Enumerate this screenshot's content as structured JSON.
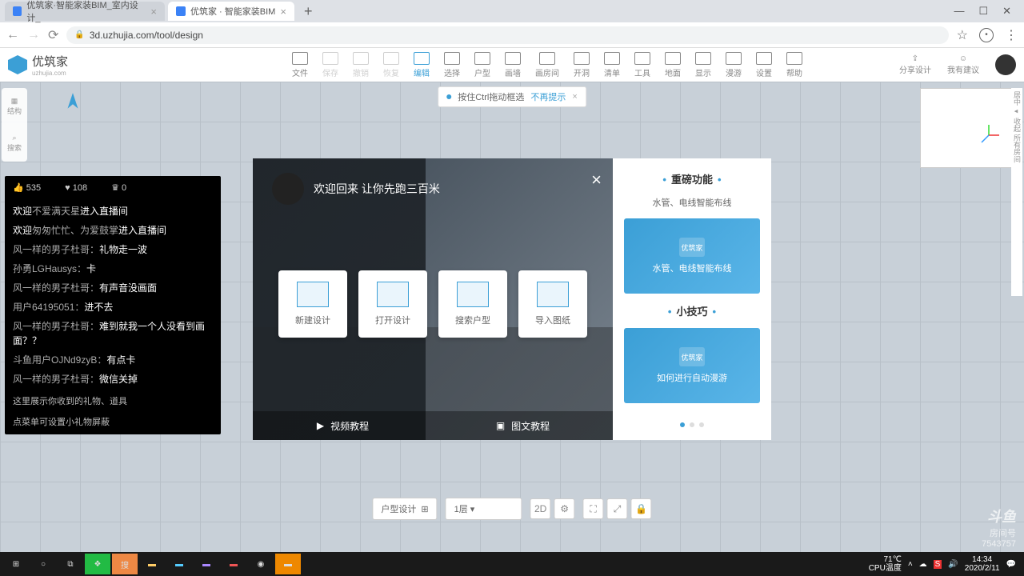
{
  "browser": {
    "tabs": [
      {
        "title": "优筑家·智能家装BIM_室内设计_",
        "active": false
      },
      {
        "title": "优筑家 · 智能家装BIM",
        "active": true
      }
    ],
    "url": "3d.uzhujia.com/tool/design"
  },
  "app": {
    "brand": "优筑家",
    "brand_sub": "uzhujia.com",
    "toolbar": [
      "文件",
      "保存",
      "撤销",
      "恢复",
      "编辑",
      "选择",
      "户型",
      "画墙",
      "画房间",
      "开洞",
      "清单",
      "工具",
      "地面",
      "显示",
      "漫游",
      "设置",
      "帮助"
    ],
    "header_right": {
      "share": "分享设计",
      "feedback": "我有建议"
    }
  },
  "tip": {
    "text": "按住Ctrl拖动框选",
    "link": "不再提示"
  },
  "left_rail": [
    {
      "label": "结构"
    },
    {
      "label": "搜索"
    }
  ],
  "chat": {
    "likes": "535",
    "hearts": "108",
    "crown": "0",
    "lines": [
      {
        "prefix": "欢迎",
        "user": "不爱满天星",
        "body": "进入直播间"
      },
      {
        "prefix": "欢迎",
        "user": "匆匆忙忙、为爱鼓掌",
        "body": "进入直播间"
      },
      {
        "prefix": "",
        "user": "风一样的男子杜哥：",
        "body": "礼物走一波"
      },
      {
        "prefix": "",
        "user": "孙勇LGHausys：",
        "body": "卡"
      },
      {
        "prefix": "",
        "user": "风一样的男子杜哥：",
        "body": "有声音没画面"
      },
      {
        "prefix": "",
        "user": "用户64195051：",
        "body": "进不去"
      },
      {
        "prefix": "",
        "user": "风一样的男子杜哥：",
        "body": "难到就我一个人没看到画面？？"
      },
      {
        "prefix": "",
        "user": "斗鱼用户OJNd9zyB：",
        "body": "有点卡"
      },
      {
        "prefix": "",
        "user": "风一样的男子杜哥：",
        "body": "微信关掉"
      }
    ],
    "footer1": "这里展示你收到的礼物、道具",
    "footer2": "点菜单可设置小礼物屏蔽"
  },
  "modal": {
    "welcome": "欢迎回来   让你先跑三百米",
    "cards": [
      "新建设计",
      "打开设计",
      "搜索户型",
      "导入图纸"
    ],
    "bottom": {
      "video": "视频教程",
      "doc": "图文教程"
    },
    "right": {
      "title1": "重磅功能",
      "sub1": "水管、电线智能布线",
      "thumb1": "水管、电线智能布线",
      "title2": "小技巧",
      "thumb2": "如何进行自动漫游"
    }
  },
  "bottom_bar": {
    "mode": "户型设计",
    "floor": "1层"
  },
  "taskbar": {
    "temp_val": "71℃",
    "temp_lbl": "CPU温度",
    "time": "14:34",
    "date": "2020/2/11"
  },
  "watermark": {
    "brand": "斗鱼",
    "label": "房间号",
    "id": "7543757"
  }
}
